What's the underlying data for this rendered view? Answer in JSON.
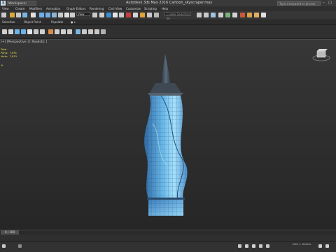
{
  "titlebar": {
    "app_logo": "3",
    "workspace": "Workspace: Default",
    "window_title": "Autodesk 3ds Max 2016    Cartoon_skyscraper.max",
    "help_search_placeholder": "Type a keyword or phrase",
    "window_controls": "– □ ×"
  },
  "menubar": {
    "items": [
      "View",
      "Create",
      "Modifiers",
      "Animation",
      "Graph Editors",
      "Rendering",
      "Civil View",
      "Customize",
      "Scripting",
      "Help"
    ]
  },
  "toolbar": {
    "view_select": "View",
    "create_selection_set_placeholder": "Create Selection Se"
  },
  "ribbon": {
    "tabs": [
      "Selection",
      "Object Paint",
      "Populate",
      "● ▾"
    ]
  },
  "viewport": {
    "label": "[+] [Perspective ] [ Realistic ]",
    "stats": "Total\nPolys:  7,691\nVerts:  7,813",
    "pct": "%"
  },
  "timeline": {
    "frame_label": "0 / 100"
  },
  "statusbar": {
    "grid": "Grid = 10,0cm"
  },
  "colors": {
    "building_light": "#8fd3f6",
    "building_dark": "#2a5f94",
    "spire": "#3d4753",
    "text_stats": "#e6e24a"
  }
}
